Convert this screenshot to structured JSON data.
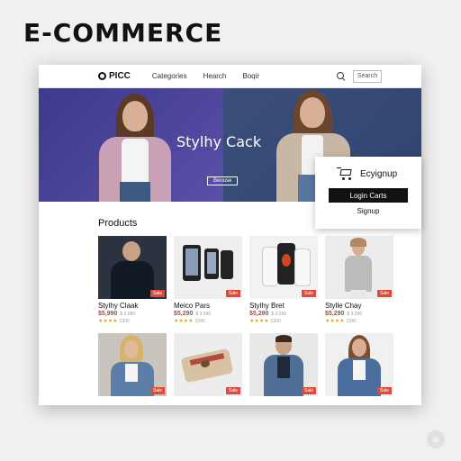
{
  "headline": "E-COMMERCE",
  "nav": {
    "logo": "PICC",
    "links": [
      "Categories",
      "Hearch",
      "Boqir"
    ],
    "search_placeholder": "Search"
  },
  "hero": {
    "title": "Stylhy Cack",
    "button": "Beouse"
  },
  "cart_popup": {
    "label": "Ecyignup",
    "login_button": "Login Carts",
    "signup": "Signup"
  },
  "products": {
    "title": "Products",
    "items": [
      {
        "name": "Stylhy Claak",
        "price": "$5,990",
        "old_price": "$ 3.990",
        "stars": "★★★★",
        "reviews": "1300",
        "badge": "Sale",
        "thumb": "dark-shirt-man"
      },
      {
        "name": "Meico Pars",
        "price": "$5,290",
        "old_price": "$ 3.590",
        "stars": "★★★★",
        "reviews": "1040",
        "badge": "Sale",
        "thumb": "phones"
      },
      {
        "name": "Stylhy Bret",
        "price": "$5,290",
        "old_price": "$ 3.290",
        "stars": "★★★★",
        "reviews": "1300",
        "badge": "Sale",
        "thumb": "white-phones"
      },
      {
        "name": "Stylle Chay",
        "price": "$5,290",
        "old_price": "$ 3.290",
        "stars": "★★★★",
        "reviews": "1340",
        "badge": "Sale",
        "thumb": "grey-dress-woman"
      },
      {
        "name": "",
        "price": "",
        "old_price": "",
        "stars": "",
        "reviews": "",
        "badge": "Sale",
        "thumb": "denim-woman"
      },
      {
        "name": "",
        "price": "",
        "old_price": "",
        "stars": "",
        "reviews": "",
        "badge": "Sale",
        "thumb": "wallet"
      },
      {
        "name": "",
        "price": "",
        "old_price": "",
        "stars": "",
        "reviews": "",
        "badge": "Sale",
        "thumb": "denim-man"
      },
      {
        "name": "",
        "price": "",
        "old_price": "",
        "stars": "",
        "reviews": "",
        "badge": "Sale",
        "thumb": "denim-jacket-woman"
      }
    ]
  },
  "ai_badge": "ai",
  "colors": {
    "accent": "#e04a3a",
    "hero_left": "#4a46a0",
    "hero_right": "#34497a",
    "button": "#111111"
  }
}
